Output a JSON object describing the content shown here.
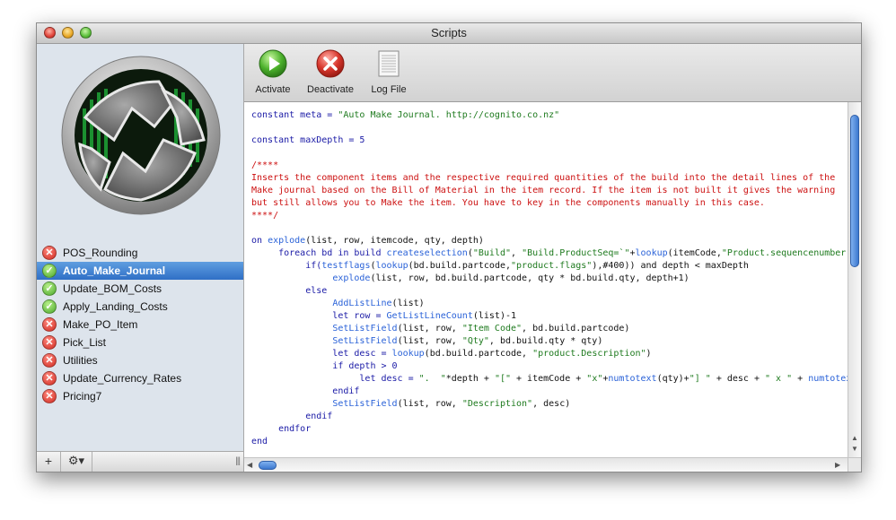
{
  "window": {
    "title": "Scripts"
  },
  "toolbar": {
    "activate_label": "Activate",
    "deactivate_label": "Deactivate",
    "logfile_label": "Log File"
  },
  "sidebar": {
    "items": [
      {
        "label": "POS_Rounding",
        "status": "inactive"
      },
      {
        "label": "Auto_Make_Journal",
        "status": "active",
        "selected": true
      },
      {
        "label": "Update_BOM_Costs",
        "status": "active"
      },
      {
        "label": "Apply_Landing_Costs",
        "status": "active"
      },
      {
        "label": "Make_PO_Item",
        "status": "inactive"
      },
      {
        "label": "Pick_List",
        "status": "inactive"
      },
      {
        "label": "Utilities",
        "status": "inactive"
      },
      {
        "label": "Update_Currency_Rates",
        "status": "inactive"
      },
      {
        "label": "Pricing7",
        "status": "inactive"
      }
    ],
    "add_label": "+",
    "gear_label": "⚙▾",
    "resize_label": "|||"
  },
  "editor": {
    "lines": [
      [
        {
          "t": "constant meta = ",
          "c": "kw"
        },
        {
          "t": "\"Auto Make Journal. http://cognito.co.nz\"",
          "c": "str"
        }
      ],
      [],
      [
        {
          "t": "constant maxDepth = 5",
          "c": "kw"
        }
      ],
      [],
      [
        {
          "t": "/****",
          "c": "cmt"
        }
      ],
      [
        {
          "t": "Inserts the component items and the respective required quantities of the build into the detail lines of the",
          "c": "cmt"
        }
      ],
      [
        {
          "t": "Make journal based on the Bill of Material in the item record. If the item is not built it gives the warning",
          "c": "cmt"
        }
      ],
      [
        {
          "t": "but still allows you to Make the item. You have to key in the components manually in this case.",
          "c": "cmt"
        }
      ],
      [
        {
          "t": "****/",
          "c": "cmt"
        }
      ],
      [],
      [
        {
          "t": "on ",
          "c": "kw"
        },
        {
          "t": "explode",
          "c": "fn"
        },
        {
          "t": "(list, row, itemcode, qty, depth)",
          "c": ""
        }
      ],
      [
        {
          "t": "     foreach bd in build ",
          "c": "kw"
        },
        {
          "t": "createselection",
          "c": "fn"
        },
        {
          "t": "(",
          "c": ""
        },
        {
          "t": "\"Build\"",
          "c": "str"
        },
        {
          "t": ", ",
          "c": ""
        },
        {
          "t": "\"Build.ProductSeq=`\"",
          "c": "str"
        },
        {
          "t": "+",
          "c": ""
        },
        {
          "t": "lookup",
          "c": "fn"
        },
        {
          "t": "(itemCode,",
          "c": ""
        },
        {
          "t": "\"Product.sequencenumber\"",
          "c": "str"
        },
        {
          "t": "),",
          "c": ""
        }
      ],
      [
        {
          "t": "          if(",
          "c": "kw"
        },
        {
          "t": "testflags",
          "c": "fn"
        },
        {
          "t": "(",
          "c": ""
        },
        {
          "t": "lookup",
          "c": "fn"
        },
        {
          "t": "(bd.build.partcode,",
          "c": ""
        },
        {
          "t": "\"product.flags\"",
          "c": "str"
        },
        {
          "t": "),#400)) and depth < maxDepth",
          "c": ""
        }
      ],
      [
        {
          "t": "               ",
          "c": ""
        },
        {
          "t": "explode",
          "c": "fn"
        },
        {
          "t": "(list, row, bd.build.partcode, qty * bd.build.qty, depth+1)",
          "c": ""
        }
      ],
      [
        {
          "t": "          else",
          "c": "kw"
        }
      ],
      [
        {
          "t": "               ",
          "c": ""
        },
        {
          "t": "AddListLine",
          "c": "fn"
        },
        {
          "t": "(list)",
          "c": ""
        }
      ],
      [
        {
          "t": "               let row = ",
          "c": "kw"
        },
        {
          "t": "GetListLineCount",
          "c": "fn"
        },
        {
          "t": "(list)-1",
          "c": ""
        }
      ],
      [
        {
          "t": "               ",
          "c": ""
        },
        {
          "t": "SetListField",
          "c": "fn"
        },
        {
          "t": "(list, row, ",
          "c": ""
        },
        {
          "t": "\"Item Code\"",
          "c": "str"
        },
        {
          "t": ", bd.build.partcode)",
          "c": ""
        }
      ],
      [
        {
          "t": "               ",
          "c": ""
        },
        {
          "t": "SetListField",
          "c": "fn"
        },
        {
          "t": "(list, row, ",
          "c": ""
        },
        {
          "t": "\"Qty\"",
          "c": "str"
        },
        {
          "t": ", bd.build.qty * qty)",
          "c": ""
        }
      ],
      [
        {
          "t": "               let desc = ",
          "c": "kw"
        },
        {
          "t": "lookup",
          "c": "fn"
        },
        {
          "t": "(bd.build.partcode, ",
          "c": ""
        },
        {
          "t": "\"product.Description\"",
          "c": "str"
        },
        {
          "t": ")",
          "c": ""
        }
      ],
      [
        {
          "t": "               if depth > 0",
          "c": "kw"
        }
      ],
      [
        {
          "t": "                    let desc = ",
          "c": "kw"
        },
        {
          "t": "\".  \"",
          "c": "str"
        },
        {
          "t": "*depth + ",
          "c": ""
        },
        {
          "t": "\"[\"",
          "c": "str"
        },
        {
          "t": " + itemCode + ",
          "c": ""
        },
        {
          "t": "\"x\"",
          "c": "str"
        },
        {
          "t": "+",
          "c": ""
        },
        {
          "t": "numtotext",
          "c": "fn"
        },
        {
          "t": "(qty)+",
          "c": ""
        },
        {
          "t": "\"] \"",
          "c": "str"
        },
        {
          "t": " + desc + ",
          "c": ""
        },
        {
          "t": "\" x \"",
          "c": "str"
        },
        {
          "t": " + ",
          "c": ""
        },
        {
          "t": "numtotext",
          "c": "fn"
        }
      ],
      [
        {
          "t": "               endif",
          "c": "kw"
        }
      ],
      [
        {
          "t": "               ",
          "c": ""
        },
        {
          "t": "SetListField",
          "c": "fn"
        },
        {
          "t": "(list, row, ",
          "c": ""
        },
        {
          "t": "\"Description\"",
          "c": "str"
        },
        {
          "t": ", desc)",
          "c": ""
        }
      ],
      [
        {
          "t": "          endif",
          "c": "kw"
        }
      ],
      [
        {
          "t": "     endfor",
          "c": "kw"
        }
      ],
      [
        {
          "t": "end",
          "c": "kw"
        }
      ]
    ]
  },
  "colors": {
    "selection": "#3b7bd4",
    "keyword": "#1a1aa6",
    "function": "#2a62d8",
    "string": "#1e7a1e",
    "comment": "#cc1010",
    "active_status": "#4aa82a",
    "inactive_status": "#d02a20"
  },
  "icons": {
    "activate": "play-icon",
    "deactivate": "x-circle-icon",
    "logfile": "document-icon",
    "active_status": "check-icon",
    "inactive_status": "x-icon"
  }
}
